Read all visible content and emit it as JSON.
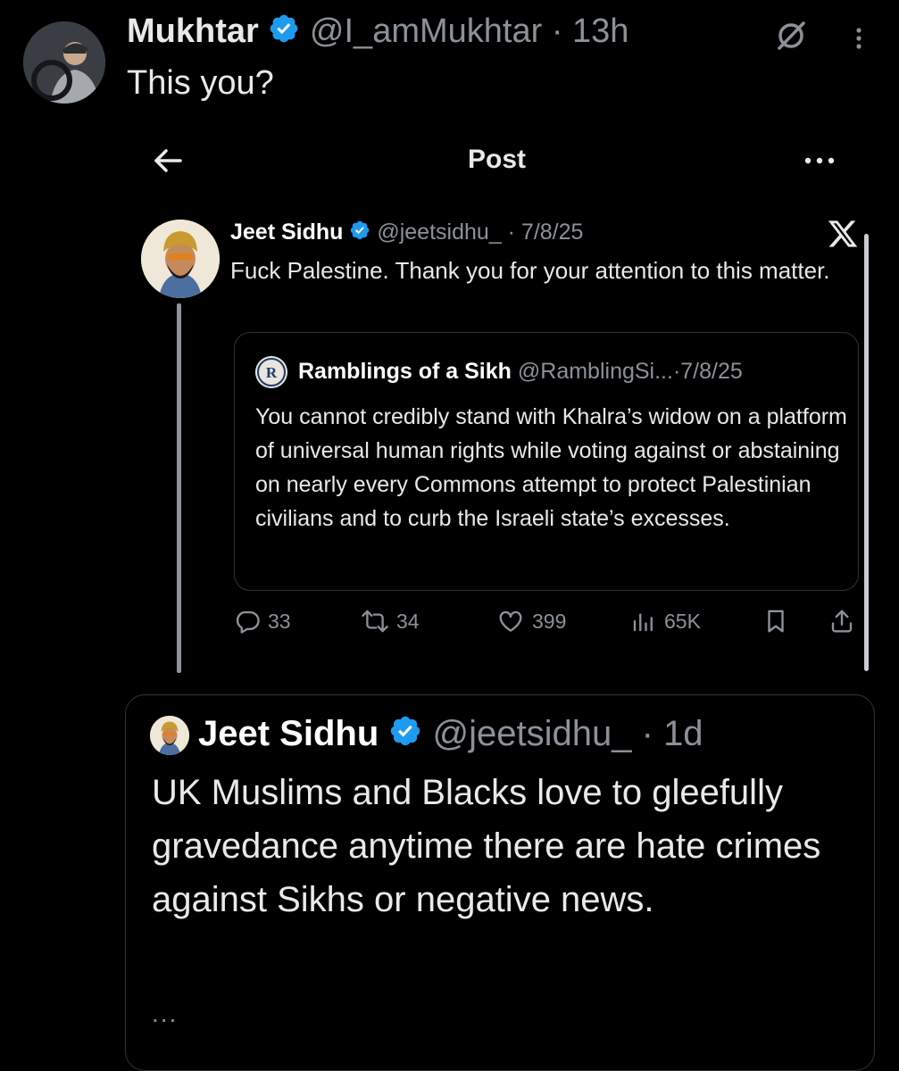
{
  "outer_post": {
    "name": "Mukhtar",
    "handle": "@I_amMukhtar",
    "separator": "·",
    "time": "13h",
    "text": "This you?"
  },
  "screenshot_header": {
    "title": "Post"
  },
  "quoted_post": {
    "name": "Jeet Sidhu",
    "handle": "@jeetsidhu_",
    "separator": "·",
    "date": "7/8/25",
    "text": "Fuck Palestine. Thank you for your attention to this matter."
  },
  "inner_quote": {
    "name": "Ramblings of a Sikh",
    "handle": "@RamblingSi...",
    "separator": "·",
    "date": "7/8/25",
    "text": "You cannot credibly stand with Khalra’s widow on a platform of universal human rights while voting against or abstaining on nearly every Commons attempt to protect Palestinian civilians and to curb the Israeli state’s excesses.",
    "avatar_letter": "R"
  },
  "actions": {
    "replies": "33",
    "reposts": "34",
    "likes": "399",
    "views": "65K"
  },
  "bottom_post": {
    "name": "Jeet Sidhu",
    "handle": "@jeetsidhu_",
    "separator": "·",
    "time": "1d",
    "text": "UK Muslims and Blacks love to gleefully gravedance anytime there are hate crimes against Sikhs or negative news.",
    "ellipsis": "..."
  },
  "colors": {
    "background": "#000000",
    "text": "#e7e9ea",
    "muted": "#8b9198",
    "verified": "#1d9bf0",
    "border": "#2f3336"
  }
}
